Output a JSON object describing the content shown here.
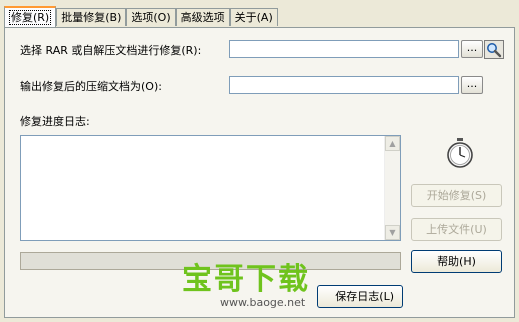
{
  "tabs": [
    {
      "label": "修复(R)",
      "active": true
    },
    {
      "label": "批量修复(B)"
    },
    {
      "label": "选项(O)"
    },
    {
      "label": "高级选项"
    },
    {
      "label": "关于(A)"
    }
  ],
  "source": {
    "label": "选择 RAR 或自解压文档进行修复(R):",
    "value": "",
    "browse_label": "..."
  },
  "output": {
    "label": "输出修复后的压缩文档为(O):",
    "value": "",
    "browse_label": "..."
  },
  "log": {
    "label": "修复进度日志:",
    "content": ""
  },
  "buttons": {
    "start": "开始修复(S)",
    "upload": "上传文件(U)",
    "help": "帮助(H)",
    "save_log": "保存日志(L)"
  },
  "watermark": {
    "title": "宝哥下载",
    "url": "www.baoge.net"
  },
  "colors": {
    "accent_tab": "#ff9933",
    "watermark_green": "#6fc31d"
  }
}
